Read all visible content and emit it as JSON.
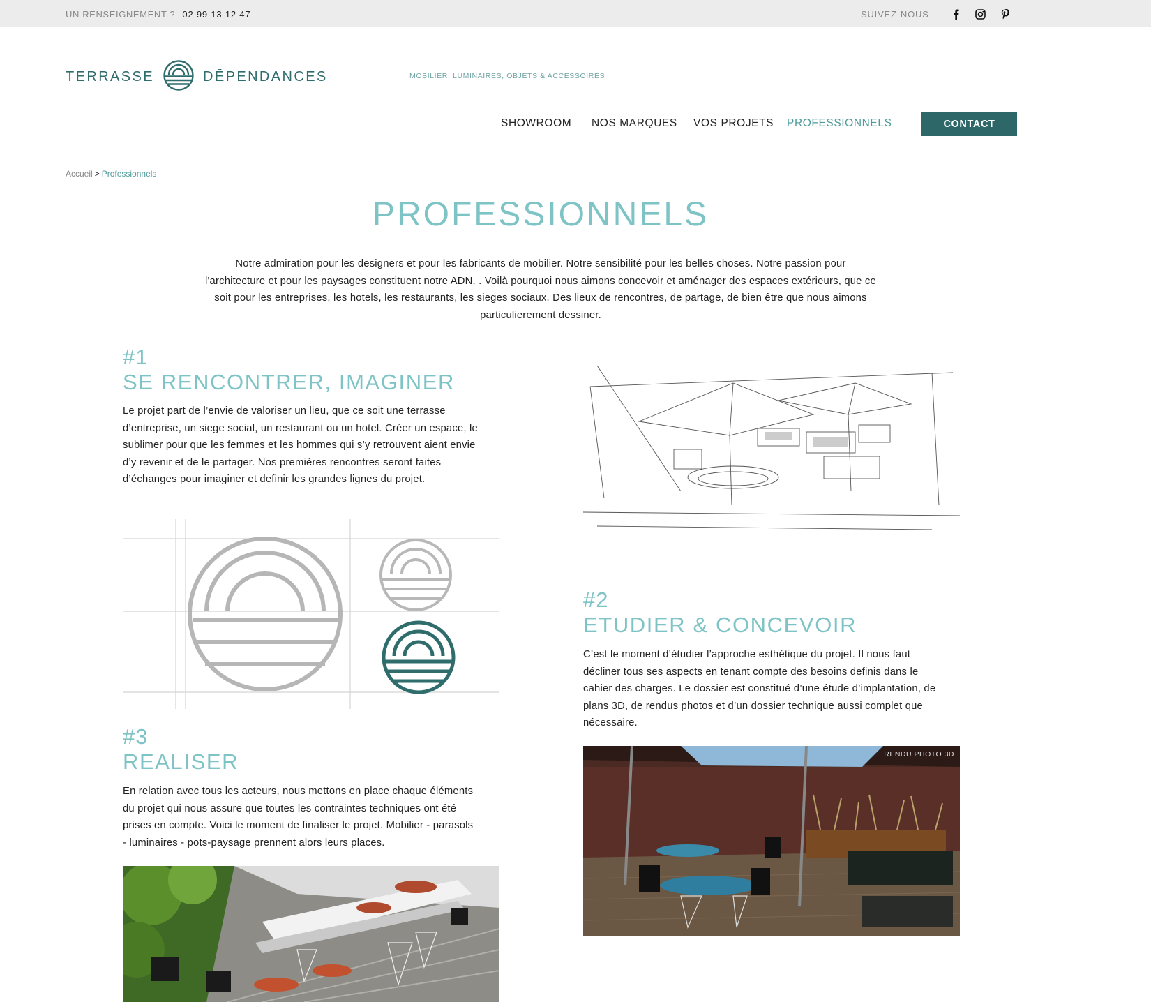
{
  "topbar": {
    "info_label": "UN RENSEIGNEMENT ?",
    "phone": "02 99 13 12 47",
    "follow_label": "SUIVEZ-NOUS",
    "social_icons": [
      "facebook-icon",
      "instagram-icon",
      "pinterest-icon"
    ]
  },
  "header": {
    "logo_left": "TERRASSE",
    "logo_right": "DĒPENDANCES",
    "tagline": "MOBILIER, LUMINAIRES, OBJETS & ACCESSOIRES"
  },
  "nav": {
    "items": [
      {
        "label": "SHOWROOM"
      },
      {
        "label": "NOS MARQUES"
      },
      {
        "label": "VOS PROJETS"
      },
      {
        "label": "PROFESSIONNELS"
      }
    ],
    "active": "PROFESSIONNELS",
    "contact": "CONTACT"
  },
  "breadcrumb": {
    "home": "Accueil",
    "separator": ">",
    "current": "Professionnels"
  },
  "page": {
    "title": "PROFESSIONNELS",
    "intro_lines": [
      "Notre admiration pour les designers et pour les fabricants de mobilier. Notre sensibilité pour les belles choses. Notre passion pour",
      "l'architecture et pour les paysages constituent notre ADN. . Voilà pourquoi nous aimons concevoir et aménager des espaces extérieurs, que ce",
      "soit pour les entreprises, les hotels, les restaurants, les sieges sociaux. Des lieux de rencontres, de partage, de bien être que nous aimons",
      "particulierement dessiner."
    ]
  },
  "sections": [
    {
      "num": "#1",
      "title": "SE RENCONTRER, IMAGINER",
      "lines": [
        "Le projet part de l’envie de valoriser un lieu, que ce soit une terrasse",
        "d’entreprise, un siege social, un restaurant ou un hotel. Créer un espace, le",
        "sublimer pour que les femmes et les hommes qui s’y retrouvent aient envie",
        "d’y revenir et de le partager. Nos premières rencontres seront faites",
        "d’échanges pour imaginer et definir les grandes lignes du projet."
      ]
    },
    {
      "num": "#2",
      "title": "ETUDIER & CONCEVOIR",
      "lines": [
        "C’est le moment d’étudier l’approche esthétique du projet. Il nous faut",
        "décliner tous ses aspects en tenant compte des besoins definis dans le",
        "cahier des charges. Le dossier est constitué d’une étude d’implantation, de",
        "plans 3D, de rendus photos et d’un dossier technique aussi complet que",
        "nécessaire."
      ]
    },
    {
      "num": "#3",
      "title": "REALISER",
      "lines": [
        "En relation avec tous les acteurs, nous mettons en place chaque éléments",
        "du projet qui nous assure que toutes les contraintes techniques ont été",
        "prises en compte. Voici le moment de finaliser le projet. Mobilier - parasols",
        "- luminaires - pots-paysage prennent alors leurs places."
      ]
    }
  ],
  "render_badge": "RENDU PHOTO 3D",
  "colors": {
    "accent": "#7ec3c5",
    "brand": "#2d6767",
    "topbar_bg": "#ececec"
  }
}
